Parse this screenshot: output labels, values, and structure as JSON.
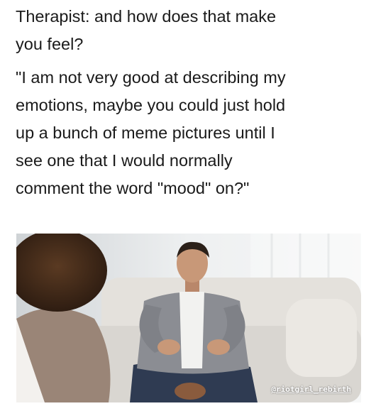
{
  "caption": {
    "line1": "Therapist: and how does that make",
    "line2": "you feel?",
    "quote_lines": [
      "\"I am not very good at describing my",
      "emotions, maybe you could just hold",
      "up a bunch of meme pictures until I",
      "see one that I would normally",
      "comment the word \"mood\" on?\""
    ]
  },
  "photo": {
    "watermark": "@riotgirl_rebirth"
  },
  "colors": {
    "text": "#1a1a1a",
    "sofa": "#e4e1dc",
    "cardigan": "#8b8d93",
    "jeans": "#2f3b52",
    "skin": "#c89878"
  }
}
